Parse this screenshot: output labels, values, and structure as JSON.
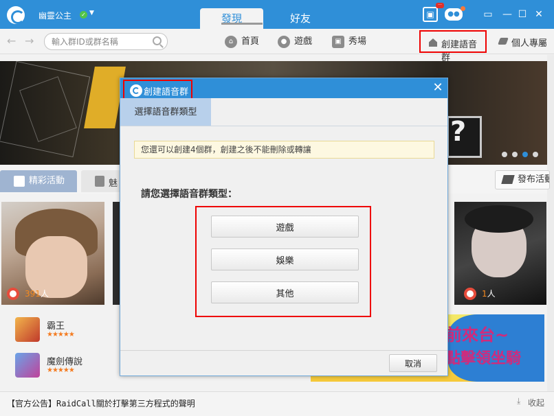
{
  "app": {
    "username": "幽靈公主",
    "status_icon": "online-check-icon",
    "tabs": [
      {
        "label": "發現",
        "active": true
      },
      {
        "label": "好友",
        "active": false
      }
    ],
    "window_buttons": {
      "min": "▭",
      "restore": "—",
      "max": "☐",
      "close": "✕"
    }
  },
  "toolbar": {
    "back": "←",
    "forward": "→",
    "search": {
      "placeholder": "輸入群ID或群名稱"
    },
    "nav": [
      {
        "label": "首頁",
        "icon": "home-icon"
      },
      {
        "label": "遊戲",
        "icon": "gamepad-icon"
      },
      {
        "label": "秀場",
        "icon": "stage-icon"
      }
    ],
    "create_group": "創建語音群",
    "personal_page": "個人專屬"
  },
  "content": {
    "banner_text": "?",
    "tabs": [
      {
        "label": "精彩活動",
        "active": true
      },
      {
        "label": "魅",
        "active": false
      }
    ],
    "publish_button": "發布活動",
    "cards": [
      {
        "count": "391",
        "unit": "人"
      },
      {
        "count": "1",
        "unit": "人"
      }
    ],
    "games": [
      {
        "name": "霸王",
        "stars": "★★★★★"
      },
      {
        "name": "魔劍傳說",
        "stars": "★★★★★"
      }
    ],
    "ad": {
      "line1": "前來台~",
      "line2": "點擊領坐騎"
    }
  },
  "footer": {
    "announcement": "【官方公告】RaidCall關於打擊第三方程式的聲明",
    "collapse": "收起"
  },
  "dialog": {
    "title": "創建語音群",
    "close": "✕",
    "tab": "選擇語音群類型",
    "notice": "您還可以創建4個群，創建之後不能刪除或轉讓",
    "prompt": "請您選擇語音群類型：",
    "choices": [
      "遊戲",
      "娛樂",
      "其他"
    ],
    "cancel": "取消"
  }
}
